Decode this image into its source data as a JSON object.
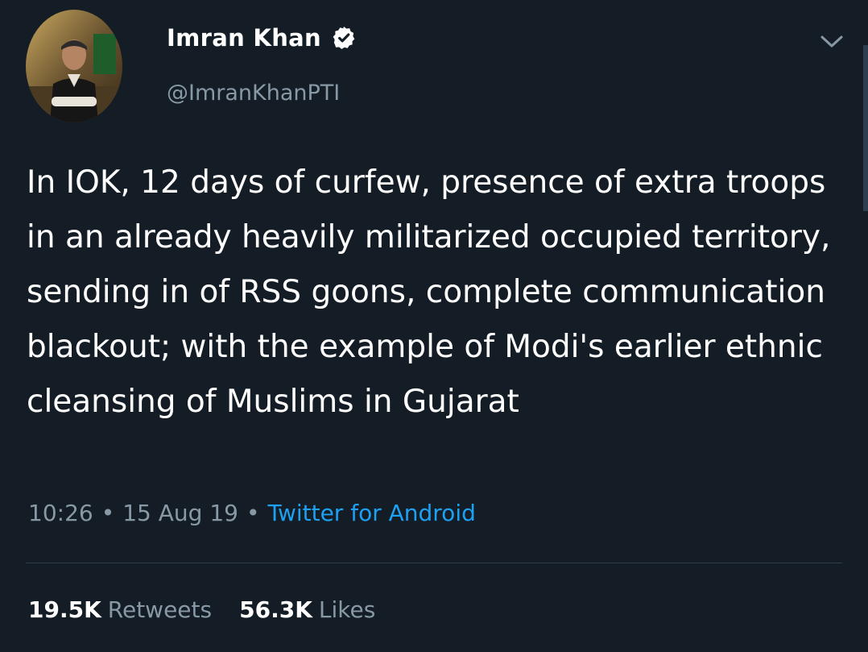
{
  "tweet": {
    "author": {
      "display_name": "Imran Khan",
      "handle": "@ImranKhanPTI",
      "verified": true
    },
    "text": "In IOK, 12 days of curfew, presence of extra troops in an already heavily militarized occupied territory, sending in of RSS goons, complete communication blackout; with the example of Modi's earlier ethnic cleansing of Muslims in Gujarat",
    "meta": {
      "time": "10:26",
      "separator": "•",
      "date": "15 Aug 19",
      "source": "Twitter for Android"
    },
    "stats": {
      "retweets_count": "19.5K",
      "retweets_label": "Retweets",
      "likes_count": "56.3K",
      "likes_label": "Likes"
    }
  },
  "colors": {
    "background": "#141d26",
    "text_primary": "#ffffff",
    "text_secondary": "#8899a6",
    "link": "#1da1f2",
    "verified_badge": "#ffffff"
  },
  "icons": {
    "verified": "verified-badge-icon",
    "more": "chevron-down-icon"
  }
}
